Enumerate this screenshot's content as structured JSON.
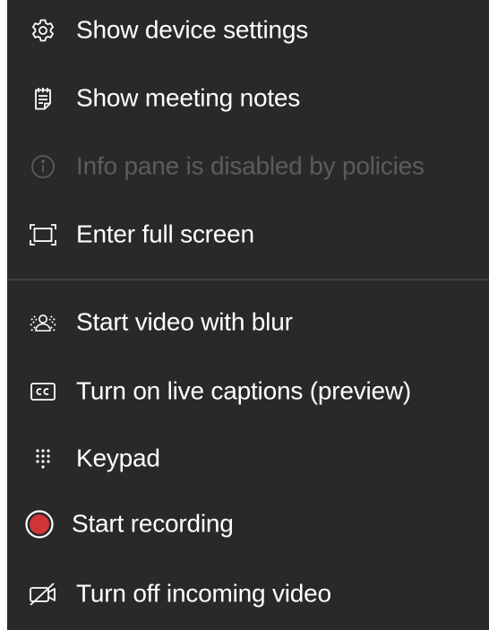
{
  "menu": {
    "items": [
      {
        "label": "Show device settings",
        "icon": "gear-icon",
        "enabled": true
      },
      {
        "label": "Show meeting notes",
        "icon": "notes-icon",
        "enabled": true
      },
      {
        "label": "Info pane is disabled by policies",
        "icon": "info-icon",
        "enabled": false
      },
      {
        "label": "Enter full screen",
        "icon": "fullscreen-icon",
        "enabled": true
      },
      {
        "label": "Start video with blur",
        "icon": "blur-background-icon",
        "enabled": true
      },
      {
        "label": "Turn on live captions (preview)",
        "icon": "closed-captions-icon",
        "enabled": true
      },
      {
        "label": "Keypad",
        "icon": "keypad-icon",
        "enabled": true
      },
      {
        "label": "Start recording",
        "icon": "record-icon",
        "enabled": true
      },
      {
        "label": "Turn off incoming video",
        "icon": "video-off-icon",
        "enabled": true
      }
    ]
  },
  "colors": {
    "background": "#292929",
    "text": "#ffffff",
    "disabled_text": "#5c5c5c",
    "divider": "#3f3f3f",
    "record_accent": "#d13438"
  }
}
